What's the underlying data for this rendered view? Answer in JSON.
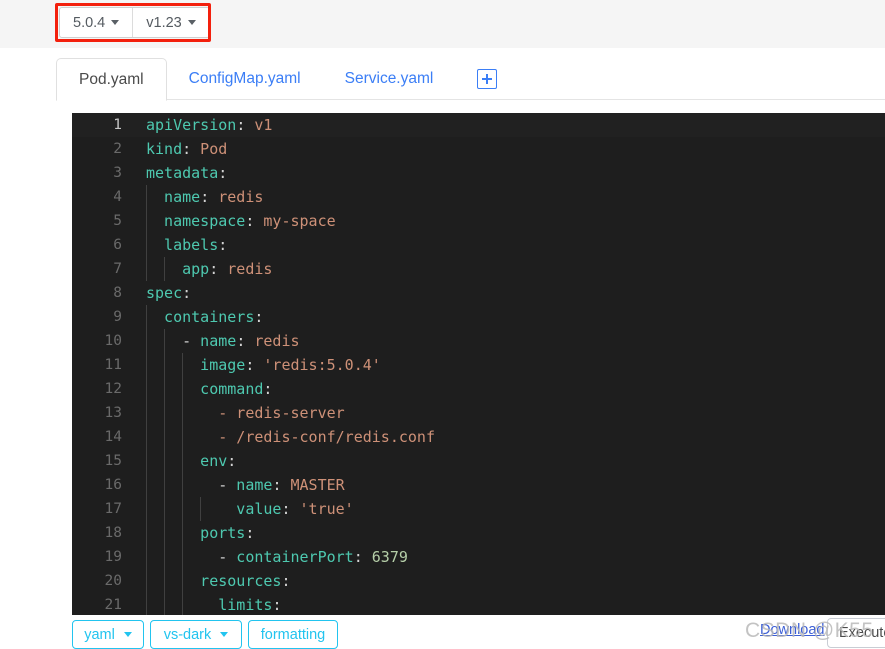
{
  "header": {
    "version_buttons": [
      {
        "label": "5.0.4",
        "icon": "chevron-down-icon"
      },
      {
        "label": "v1.23",
        "icon": "chevron-down-icon"
      }
    ],
    "annotation_color": "#f3200d",
    "band_color": "#f5f5f5"
  },
  "tabs": {
    "items": [
      {
        "label": "Pod.yaml",
        "active": true
      },
      {
        "label": "ConfigMap.yaml",
        "active": false
      },
      {
        "label": "Service.yaml",
        "active": false
      }
    ],
    "add_button_icon": "plus-icon",
    "active_color": "#4a4a4a",
    "inactive_color": "#3b7ef6"
  },
  "editor": {
    "language": "yaml",
    "theme": "vs-dark",
    "background": "#1e1e1e",
    "current_line": 1,
    "lines": [
      {
        "num": "1",
        "guides": 0,
        "tokens": [
          {
            "t": "apiVersion",
            "c": "k"
          },
          {
            "t": ":",
            "c": "p"
          },
          {
            "t": " v1",
            "c": "s"
          }
        ]
      },
      {
        "num": "2",
        "guides": 0,
        "tokens": [
          {
            "t": "kind",
            "c": "k"
          },
          {
            "t": ":",
            "c": "p"
          },
          {
            "t": " Pod",
            "c": "s"
          }
        ]
      },
      {
        "num": "3",
        "guides": 0,
        "tokens": [
          {
            "t": "metadata",
            "c": "k"
          },
          {
            "t": ":",
            "c": "p"
          }
        ]
      },
      {
        "num": "4",
        "guides": 1,
        "tokens": [
          {
            "t": "  name",
            "c": "k"
          },
          {
            "t": ":",
            "c": "p"
          },
          {
            "t": " redis",
            "c": "s"
          }
        ]
      },
      {
        "num": "5",
        "guides": 1,
        "tokens": [
          {
            "t": "  namespace",
            "c": "k"
          },
          {
            "t": ":",
            "c": "p"
          },
          {
            "t": " my-space",
            "c": "s"
          }
        ]
      },
      {
        "num": "6",
        "guides": 1,
        "tokens": [
          {
            "t": "  labels",
            "c": "k"
          },
          {
            "t": ":",
            "c": "p"
          }
        ]
      },
      {
        "num": "7",
        "guides": 2,
        "tokens": [
          {
            "t": "    app",
            "c": "k"
          },
          {
            "t": ":",
            "c": "p"
          },
          {
            "t": " redis",
            "c": "s"
          }
        ]
      },
      {
        "num": "8",
        "guides": 0,
        "tokens": [
          {
            "t": "spec",
            "c": "k"
          },
          {
            "t": ":",
            "c": "p"
          }
        ]
      },
      {
        "num": "9",
        "guides": 1,
        "tokens": [
          {
            "t": "  containers",
            "c": "k"
          },
          {
            "t": ":",
            "c": "p"
          }
        ]
      },
      {
        "num": "10",
        "guides": 2,
        "tokens": [
          {
            "t": "    -",
            "c": "p"
          },
          {
            "t": " name",
            "c": "k"
          },
          {
            "t": ":",
            "c": "p"
          },
          {
            "t": " redis",
            "c": "s"
          }
        ]
      },
      {
        "num": "11",
        "guides": 3,
        "tokens": [
          {
            "t": "      image",
            "c": "k"
          },
          {
            "t": ":",
            "c": "p"
          },
          {
            "t": " 'redis:5.0.4'",
            "c": "s"
          }
        ]
      },
      {
        "num": "12",
        "guides": 3,
        "tokens": [
          {
            "t": "      command",
            "c": "k"
          },
          {
            "t": ":",
            "c": "p"
          }
        ]
      },
      {
        "num": "13",
        "guides": 3,
        "tokens": [
          {
            "t": "        - redis-server",
            "c": "s"
          }
        ]
      },
      {
        "num": "14",
        "guides": 3,
        "tokens": [
          {
            "t": "        - /redis-conf/redis.conf",
            "c": "s"
          }
        ]
      },
      {
        "num": "15",
        "guides": 3,
        "tokens": [
          {
            "t": "      env",
            "c": "k"
          },
          {
            "t": ":",
            "c": "p"
          }
        ]
      },
      {
        "num": "16",
        "guides": 3,
        "tokens": [
          {
            "t": "        -",
            "c": "p"
          },
          {
            "t": " name",
            "c": "k"
          },
          {
            "t": ":",
            "c": "p"
          },
          {
            "t": " MASTER",
            "c": "s"
          }
        ]
      },
      {
        "num": "17",
        "guides": 4,
        "tokens": [
          {
            "t": "          value",
            "c": "k"
          },
          {
            "t": ":",
            "c": "p"
          },
          {
            "t": " 'true'",
            "c": "s"
          }
        ]
      },
      {
        "num": "18",
        "guides": 3,
        "tokens": [
          {
            "t": "      ports",
            "c": "k"
          },
          {
            "t": ":",
            "c": "p"
          }
        ]
      },
      {
        "num": "19",
        "guides": 3,
        "tokens": [
          {
            "t": "        -",
            "c": "p"
          },
          {
            "t": " containerPort",
            "c": "k"
          },
          {
            "t": ":",
            "c": "p"
          },
          {
            "t": " 6379",
            "c": "n"
          }
        ]
      },
      {
        "num": "20",
        "guides": 3,
        "tokens": [
          {
            "t": "      resources",
            "c": "k"
          },
          {
            "t": ":",
            "c": "p"
          }
        ]
      },
      {
        "num": "21",
        "guides": 3,
        "tokens": [
          {
            "t": "        limits",
            "c": "k"
          },
          {
            "t": ":",
            "c": "p"
          }
        ]
      }
    ]
  },
  "toolbar": {
    "language_label": "yaml",
    "theme_label": "vs-dark",
    "format_label": "formatting",
    "download_label": "Download",
    "execute_label": "Execute",
    "accent_color": "#22c4ef",
    "link_color": "#3b5ed6"
  },
  "watermark": {
    "text": "CSDN @K55"
  }
}
